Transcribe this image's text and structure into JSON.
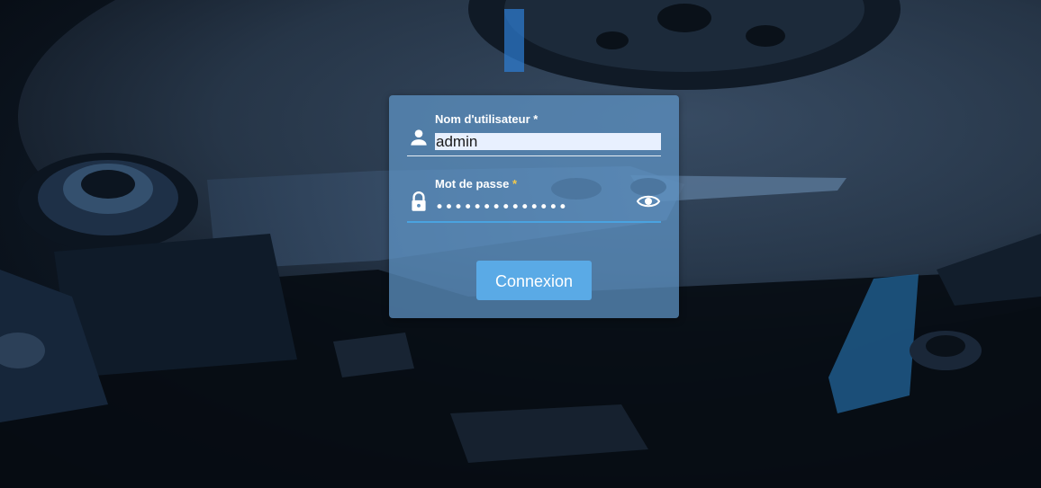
{
  "login": {
    "username_label": "Nom d'utilisateur",
    "username_required_mark": "*",
    "username_value": "admin",
    "password_label": "Mot de passe",
    "password_required_mark": "*",
    "password_masked": "••••••••••••••",
    "submit_label": "Connexion"
  },
  "icons": {
    "username": "user-icon",
    "password": "lock-icon",
    "toggle_visibility": "eye-icon"
  },
  "colors": {
    "card_background": "#6096c8",
    "button_background": "#5aaae6",
    "focus_underline": "#4aa3e0",
    "required_star_password": "#f2c94c",
    "autofill_background": "#e8f0fe"
  }
}
